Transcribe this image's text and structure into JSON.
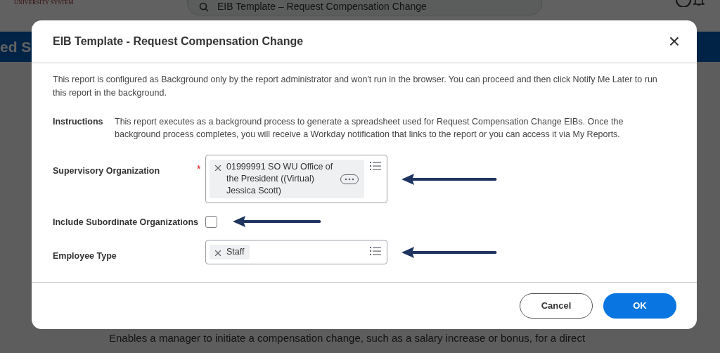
{
  "background": {
    "logo_text": "UNIVERSITY SYSTEM",
    "search": {
      "value": "EIB Template – Request Compensation Change"
    },
    "banner_title": "ed S",
    "description": "Enables a manager to initiate a compensation change, such as a salary increase or bonus, for a direct"
  },
  "dialog": {
    "title": "EIB Template - Request Compensation Change",
    "close_icon": "×",
    "notice": "This report is configured as Background only by the report administrator and won't run in the browser. You can proceed and then click Notify Me Later to run this report in the background.",
    "instructions": {
      "label": "Instructions",
      "text": "This report executes as a background process to generate a spreadsheet used for Request Compensation Change EIBs. Once the background process completes, you will receive a Workday notification that links to the report or you can access it via My Reports."
    },
    "fields": [
      {
        "kind": "multiselect",
        "label": "Supervisory Organization",
        "required_mark": "*",
        "chips": [
          {
            "text": "01999991 SO WU Office of the President ((Virtual) Jessica Scott)",
            "has_menu": true
          }
        ],
        "annotated": true
      },
      {
        "kind": "checkbox",
        "label": "Include Subordinate Organizations",
        "checked": false,
        "annotated": true
      },
      {
        "kind": "multiselect",
        "label": "Employee Type",
        "chips": [
          {
            "text": "Staff",
            "has_menu": false
          }
        ],
        "annotated": true
      }
    ],
    "buttons": [
      {
        "label": "Cancel",
        "primary": false
      },
      {
        "label": "OK",
        "primary": true
      }
    ]
  }
}
